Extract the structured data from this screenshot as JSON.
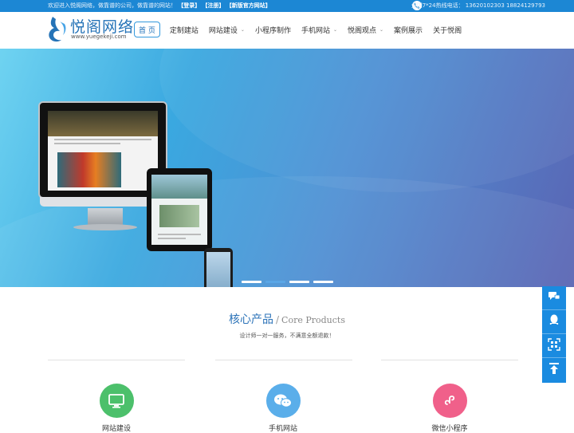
{
  "topbar": {
    "welcome": "欢迎进入悦阁网络，做靠谱的公司，做靠谱的网站！",
    "login": "【登录】",
    "register": "【注册】",
    "new_site": "【新版官方网站】",
    "hotline": "全国7*24热线电话： 13620102303 18824129793"
  },
  "logo": {
    "title": "悦阁网络",
    "subtitle": "www.yuegekeji.com"
  },
  "nav": {
    "items": [
      {
        "label": "首 页",
        "active": true,
        "has_dropdown": false
      },
      {
        "label": "定制建站",
        "active": false,
        "has_dropdown": false
      },
      {
        "label": "网站建设",
        "active": false,
        "has_dropdown": true
      },
      {
        "label": "小程序制作",
        "active": false,
        "has_dropdown": false
      },
      {
        "label": "手机网站",
        "active": false,
        "has_dropdown": true
      },
      {
        "label": "悦阁观点",
        "active": false,
        "has_dropdown": true
      },
      {
        "label": "案例展示",
        "active": false,
        "has_dropdown": false
      },
      {
        "label": "关于悦阁",
        "active": false,
        "has_dropdown": false
      }
    ],
    "chevron": "⌄"
  },
  "banner": {
    "slides_count": 4,
    "active_slide": 1
  },
  "section": {
    "title_cn": "核心产品",
    "separator": "/",
    "title_en": "Core Products",
    "subtitle": "设计师一对一服务，不满意全额退款！"
  },
  "products": [
    {
      "label": "网站建设",
      "icon": "monitor-icon",
      "color": "#4cc06b"
    },
    {
      "label": "手机网站",
      "icon": "wechat-icon",
      "color": "#5aaeea"
    },
    {
      "label": "微信小程序",
      "icon": "mini-program-icon",
      "color": "#f0608a"
    }
  ],
  "floating_toolbar": {
    "buttons": [
      "chat-icon",
      "qq-icon",
      "qrcode-icon",
      "back-to-top-icon"
    ]
  },
  "colors": {
    "brand": "#1c87d4",
    "title": "#2c73b8",
    "active_dot": "#5aa6e6"
  }
}
